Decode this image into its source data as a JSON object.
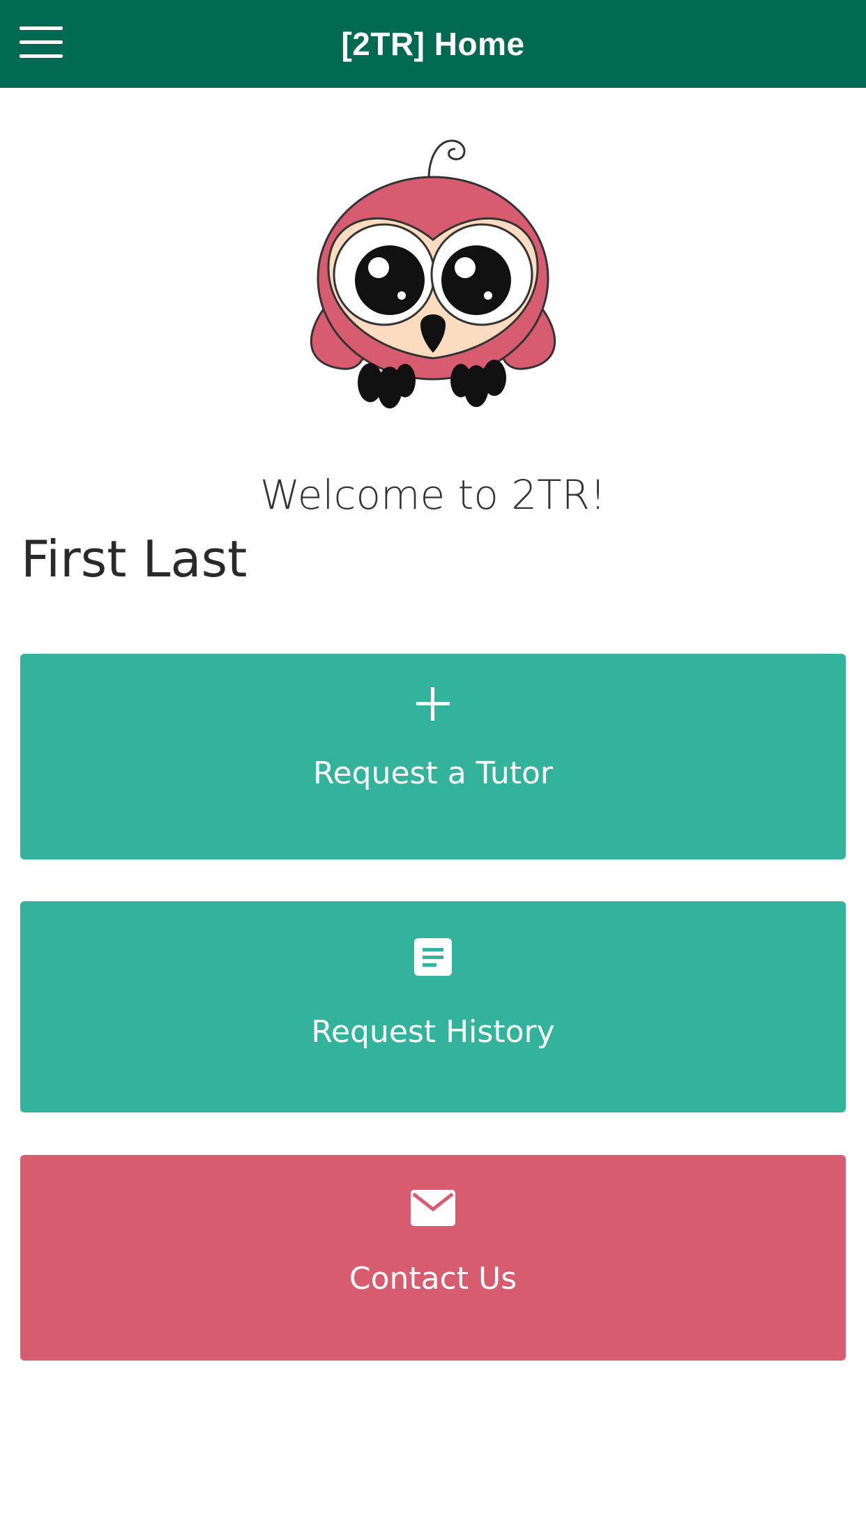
{
  "app_bar": {
    "title": "[2TR] Home",
    "menu_icon": "hamburger-menu-icon",
    "background": "#026952"
  },
  "mascot": {
    "description_icon": "owl-mascot",
    "primary_color": "#d85c6f"
  },
  "welcome": {
    "text": "Welcome to 2TR!"
  },
  "user": {
    "name": "First Last"
  },
  "actions": [
    {
      "label": "Request a Tutor",
      "icon": "plus-icon",
      "color": "#33b29c"
    },
    {
      "label": "Request History",
      "icon": "document-icon",
      "color": "#33b29c"
    },
    {
      "label": "Contact Us",
      "icon": "envelope-icon",
      "color": "#d85c6f"
    }
  ]
}
